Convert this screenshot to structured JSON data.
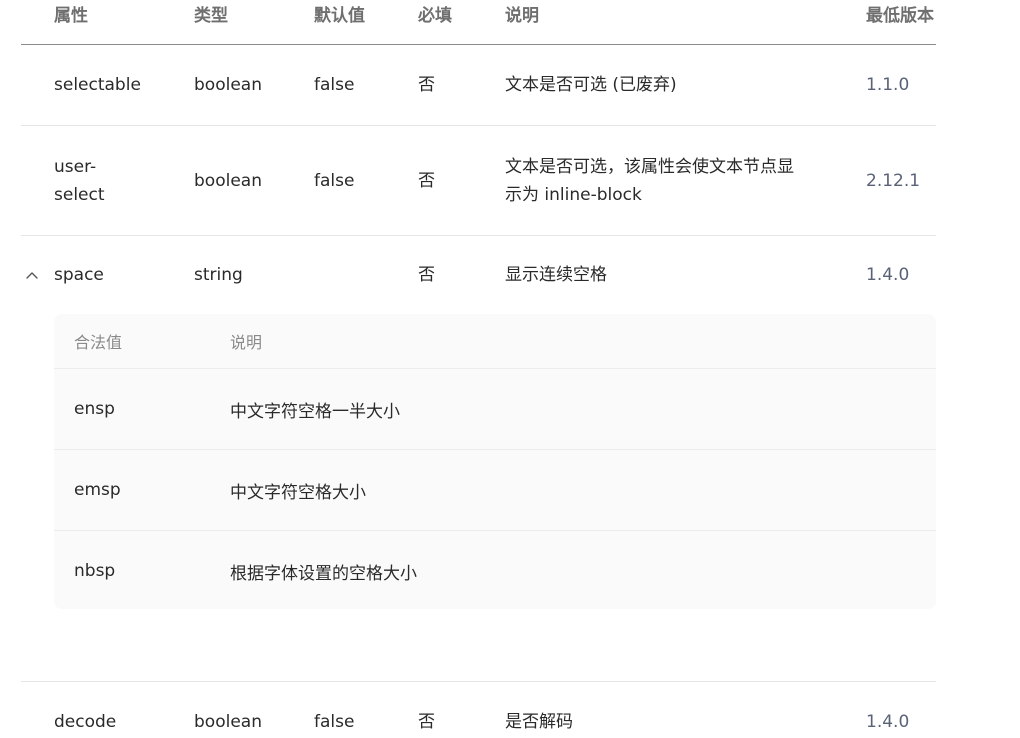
{
  "table": {
    "headers": {
      "name": "属性",
      "type": "类型",
      "default": "默认值",
      "required": "必填",
      "description": "说明",
      "version": "最低版本"
    },
    "rows": [
      {
        "name": "selectable",
        "type": "boolean",
        "default": "false",
        "required": "否",
        "description": "文本是否可选 (已废弃)",
        "version": "1.1.0"
      },
      {
        "name_line1": "user-",
        "name_line2": "select",
        "type": "boolean",
        "default": "false",
        "required": "否",
        "description_line1": "文本是否可选，该属性会使文本节点显",
        "description_line2": "示为 inline-block",
        "version": "2.12.1"
      },
      {
        "name": "space",
        "type": "string",
        "default": "",
        "required": "否",
        "description": "显示连续空格",
        "version": "1.4.0",
        "expanded": true,
        "toggle_icon": "chevron-up-icon"
      },
      {
        "name": "decode",
        "type": "boolean",
        "default": "false",
        "required": "否",
        "description": "是否解码",
        "version": "1.4.0"
      }
    ],
    "space_values": {
      "headers": {
        "value": "合法值",
        "description": "说明"
      },
      "rows": [
        {
          "value": "ensp",
          "description": "中文字符空格一半大小"
        },
        {
          "value": "emsp",
          "description": "中文字符空格大小"
        },
        {
          "value": "nbsp",
          "description": "根据字体设置的空格大小"
        }
      ]
    }
  }
}
